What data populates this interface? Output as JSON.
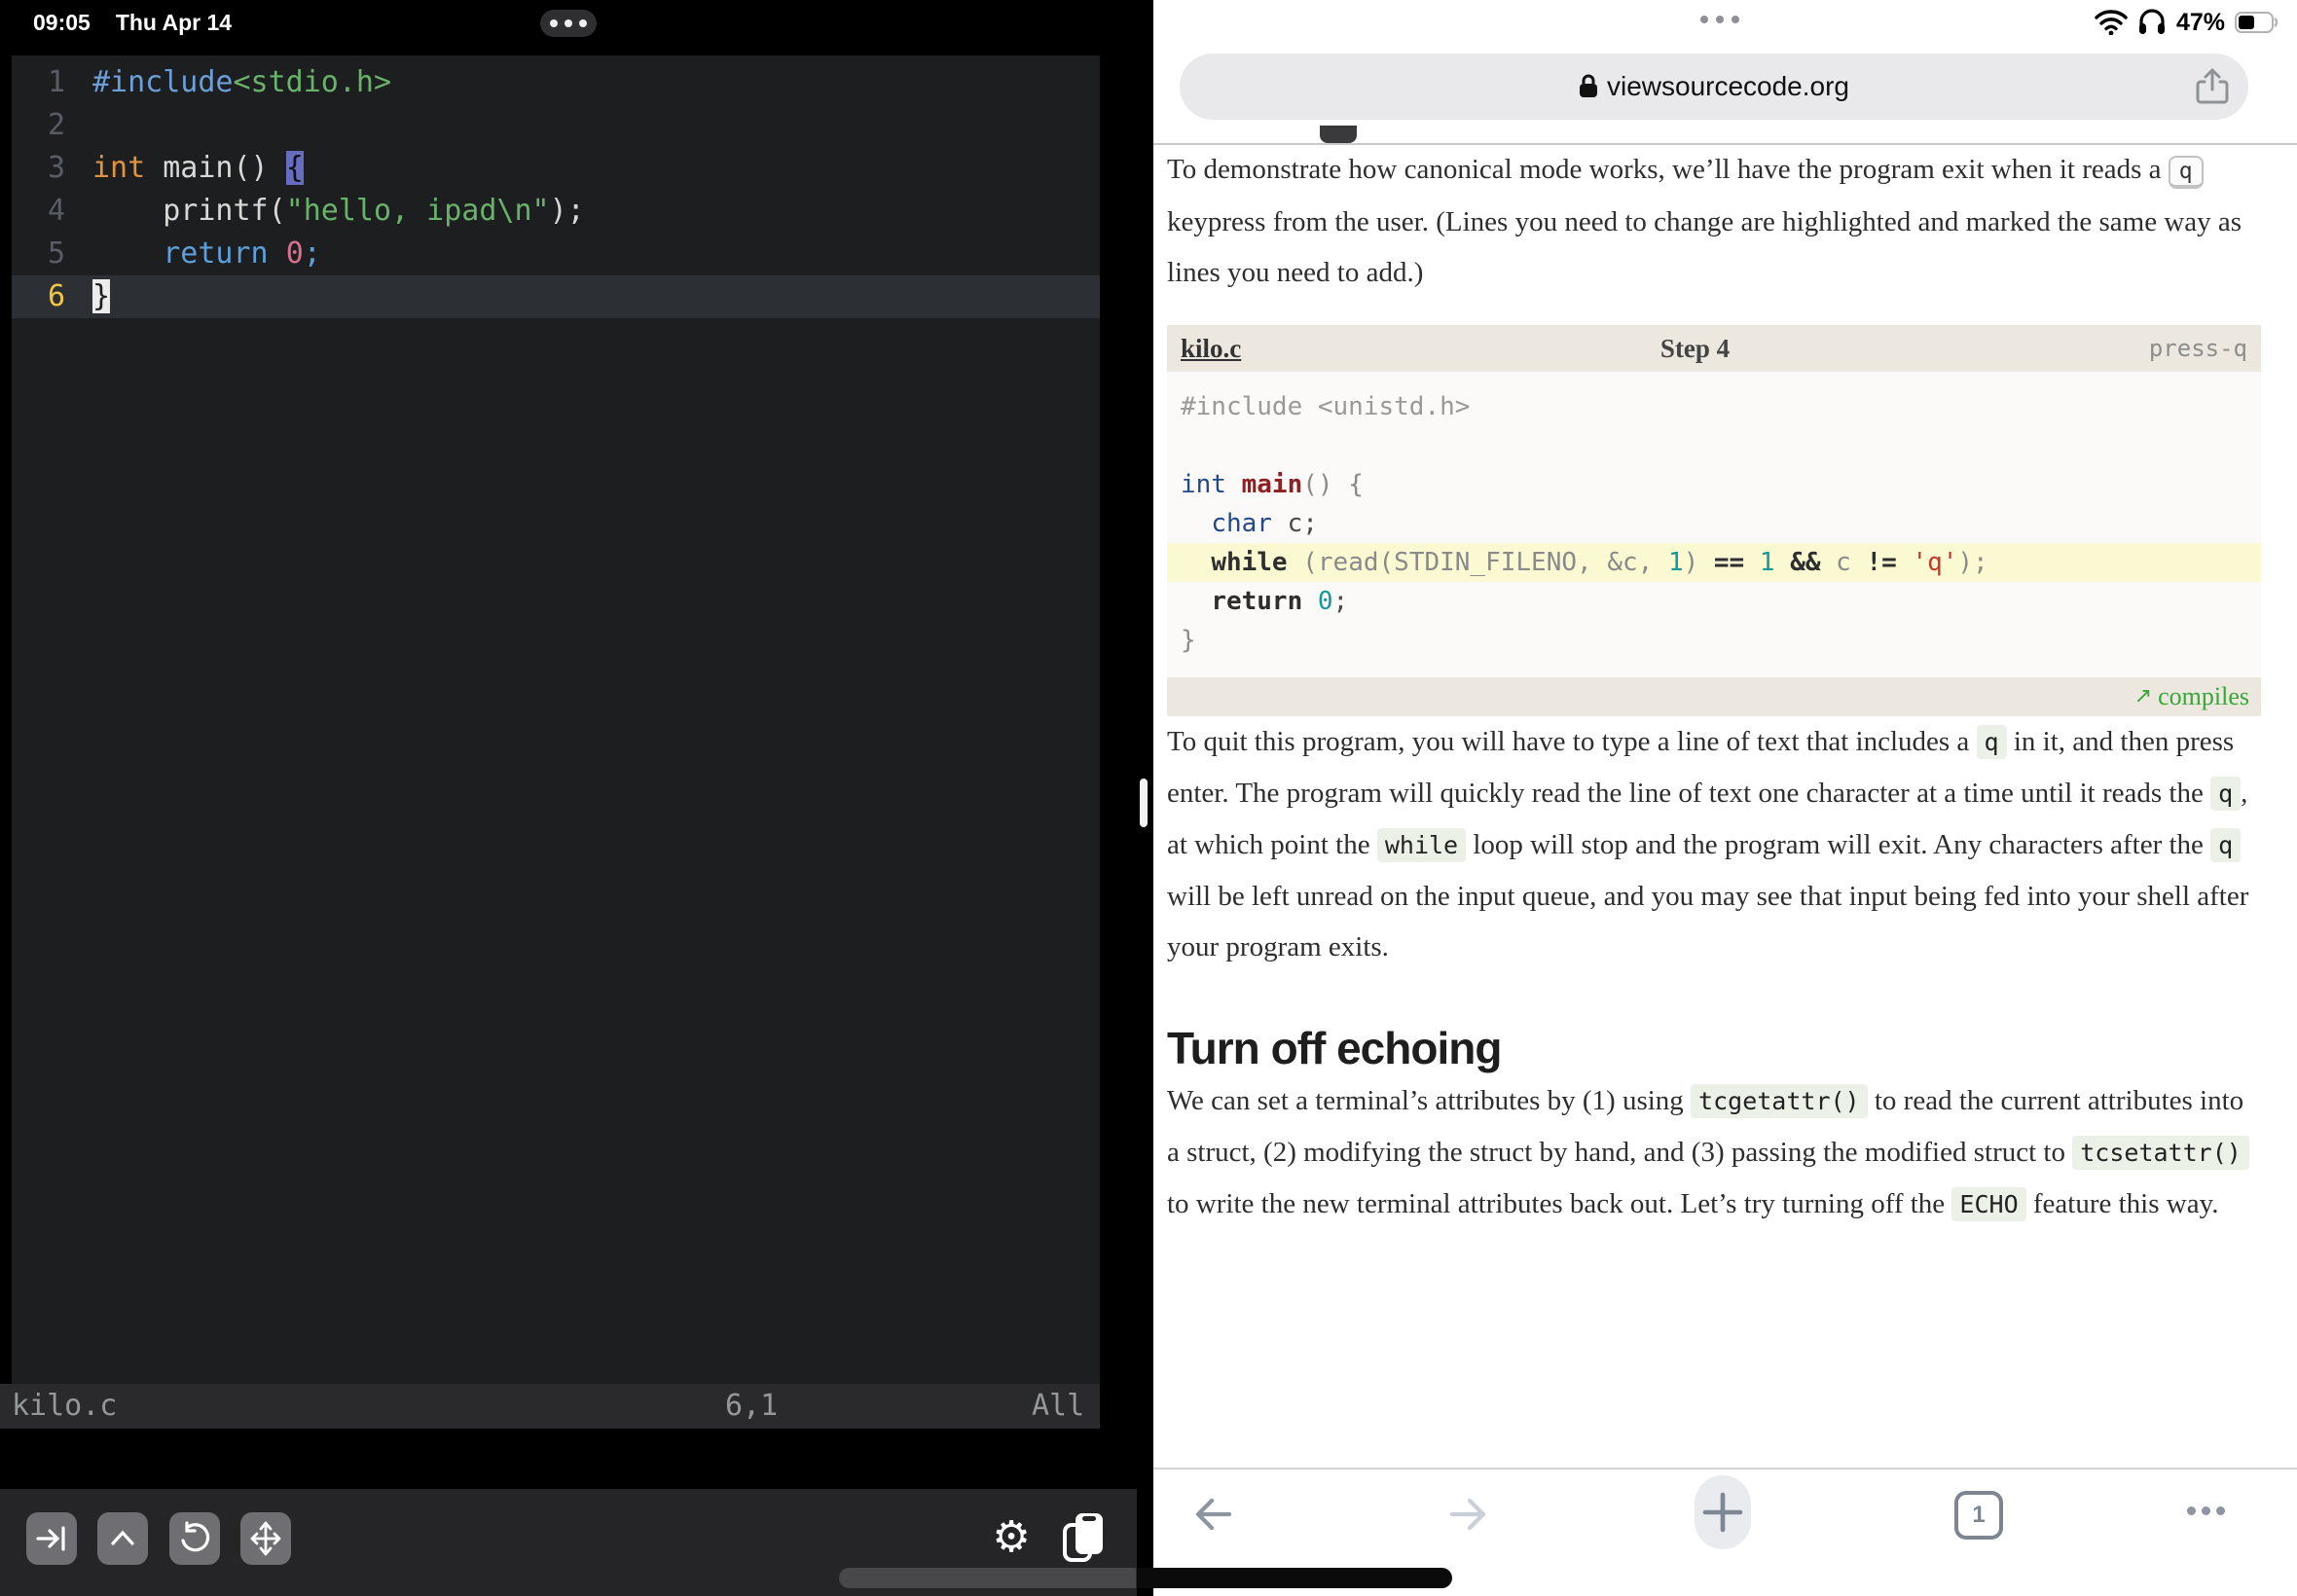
{
  "left_app": {
    "status": {
      "time": "09:05",
      "date": "Thu Apr 14"
    },
    "editor": {
      "lines": [
        {
          "num": "1",
          "tokens": [
            {
              "t": "#include",
              "c": "vblue"
            },
            {
              "t": "<stdio.h>",
              "c": "vgreen"
            }
          ]
        },
        {
          "num": "2",
          "tokens": []
        },
        {
          "num": "3",
          "tokens": [
            {
              "t": "int",
              "c": "vorange"
            },
            {
              "t": " main() ",
              "c": "vfg"
            },
            {
              "t": "{",
              "c": "vmatch"
            }
          ]
        },
        {
          "num": "4",
          "tokens": [
            {
              "t": "    printf(",
              "c": "vfg"
            },
            {
              "t": "\"hello, ipad\\n\"",
              "c": "vgreen"
            },
            {
              "t": ");",
              "c": "vfg"
            }
          ]
        },
        {
          "num": "5",
          "tokens": [
            {
              "t": "    ",
              "c": "vfg"
            },
            {
              "t": "return",
              "c": "vblue2"
            },
            {
              "t": " ",
              "c": "vfg"
            },
            {
              "t": "0",
              "c": "vpink"
            },
            {
              "t": ";",
              "c": "vblue2"
            }
          ]
        },
        {
          "num": "6",
          "current": true,
          "tokens": [
            {
              "t": "}",
              "c": "vcursor"
            }
          ]
        }
      ],
      "status_bar": {
        "file": "kilo.c",
        "position": "6,1",
        "scroll": "All"
      }
    },
    "toolbar": {
      "keys": [
        "tab-key",
        "control-key",
        "undo-key",
        "move-arrows-key"
      ],
      "icons": [
        "settings-gear",
        "clipboard-paste"
      ]
    }
  },
  "right_app": {
    "system_status": {
      "battery": "47%",
      "icons": [
        "wifi-icon",
        "headphones-icon",
        "battery-icon"
      ]
    },
    "address_bar": {
      "url": "viewsourcecode.org",
      "lock_icon": "lock-icon",
      "share_icon": "share-icon"
    },
    "article": {
      "p1": [
        {
          "text": "To demonstrate how canonical mode works, we’ll have the program exit when it reads a "
        },
        {
          "text": "q",
          "style": "kbd"
        },
        {
          "text": " keypress from the user. (Lines you need to change are highlighted and marked the same way as lines you need to add.)"
        }
      ],
      "code_block": {
        "file": "kilo.c",
        "step": "Step 4",
        "tag": "press-q",
        "lines": [
          {
            "tokens": [
              {
                "t": "#include <unistd.h>",
                "c": "cm"
              }
            ]
          },
          {
            "tokens": []
          },
          {
            "tokens": [
              {
                "t": "int",
                "c": "ty"
              },
              {
                "t": " ",
                "c": "pl"
              },
              {
                "t": "main",
                "c": "fn"
              },
              {
                "t": "() {",
                "c": "pl"
              }
            ]
          },
          {
            "tokens": [
              {
                "t": "  ",
                "c": "pl"
              },
              {
                "t": "char",
                "c": "ty"
              },
              {
                "t": " c;",
                "c": "pl2"
              }
            ]
          },
          {
            "hl": true,
            "tokens": [
              {
                "t": "  ",
                "c": "pl"
              },
              {
                "t": "while",
                "c": "kw"
              },
              {
                "t": " (read(STDIN_FILENO, &c, ",
                "c": "pl"
              },
              {
                "t": "1",
                "c": "nu"
              },
              {
                "t": ") ",
                "c": "pl"
              },
              {
                "t": "==",
                "c": "kw"
              },
              {
                "t": " ",
                "c": "pl"
              },
              {
                "t": "1",
                "c": "nu"
              },
              {
                "t": " ",
                "c": "pl"
              },
              {
                "t": "&&",
                "c": "kw"
              },
              {
                "t": " c ",
                "c": "pl"
              },
              {
                "t": "!=",
                "c": "kw"
              },
              {
                "t": " ",
                "c": "pl"
              },
              {
                "t": "'q'",
                "c": "st"
              },
              {
                "t": ");",
                "c": "pl"
              }
            ]
          },
          {
            "tokens": [
              {
                "t": "  ",
                "c": "pl"
              },
              {
                "t": "return",
                "c": "kw"
              },
              {
                "t": " ",
                "c": "pl"
              },
              {
                "t": "0",
                "c": "nu"
              },
              {
                "t": ";",
                "c": "pl2"
              }
            ]
          },
          {
            "tokens": [
              {
                "t": "}",
                "c": "pl"
              }
            ]
          }
        ],
        "footer_arrow": "↗",
        "footer_link": "compiles"
      },
      "p2": [
        {
          "text": "To quit this program, you will have to type a line of text that includes a "
        },
        {
          "text": "q",
          "style": "code"
        },
        {
          "text": " in it, and then press enter. The program will quickly read the line of text one character at a time until it reads the "
        },
        {
          "text": "q",
          "style": "code"
        },
        {
          "text": ", at which point the "
        },
        {
          "text": "while",
          "style": "code"
        },
        {
          "text": " loop will stop and the program will exit. Any characters after the "
        },
        {
          "text": "q",
          "style": "code"
        },
        {
          "text": " will be left unread on the input queue, and you may see that input being fed into your shell after your program exits."
        }
      ],
      "heading": "Turn off echoing",
      "p3": [
        {
          "text": "We can set a terminal’s attributes by (1) using "
        },
        {
          "text": "tcgetattr()",
          "style": "code"
        },
        {
          "text": " to read the current attributes into a struct, (2) modifying the struct by hand, and (3) passing the modified struct to "
        },
        {
          "text": "tcsetattr()",
          "style": "code"
        },
        {
          "text": " to write the new terminal attributes back out. Let’s try turning off the "
        },
        {
          "text": "ECHO",
          "style": "code"
        },
        {
          "text": " feature this way."
        }
      ]
    },
    "toolbar": {
      "tab_count": "1",
      "items": [
        "back",
        "forward",
        "new-tab",
        "tabs",
        "more"
      ]
    }
  }
}
